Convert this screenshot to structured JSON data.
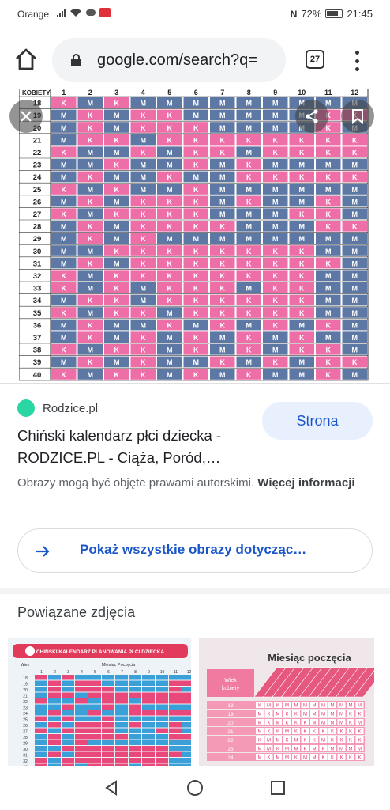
{
  "status_bar": {
    "carrier": "Orange",
    "nfc": "N",
    "battery": "72%",
    "time": "21:45"
  },
  "browser": {
    "url": "google.com/search?q=",
    "tab_count": "27"
  },
  "image_preview": {
    "header_row_label": "KOBIETY",
    "months": [
      "1",
      "2",
      "3",
      "4",
      "5",
      "6",
      "7",
      "8",
      "9",
      "10",
      "11",
      "12"
    ],
    "ages": [
      "18",
      "19",
      "20",
      "21",
      "22",
      "23",
      "24",
      "25",
      "26",
      "27",
      "28",
      "29",
      "30",
      "31",
      "32",
      "33",
      "34",
      "35",
      "36",
      "37",
      "38",
      "39",
      "40"
    ],
    "rows": [
      "KMKMMMMMMMMM",
      "MKMKKMMMMMKK",
      "MKMKKKMMMMKM",
      "MKKMKKKKKKKK",
      "KMMKMKKMKKKK",
      "MMKMMKMKMMMM",
      "MKMMKMMKKKKK",
      "KMKMMKMMMMMM",
      "MKMKKKMKMMKM",
      "KMKKKKMMMKKM",
      "MKMKKKKMMMKK",
      "MKMKMMMMMMMM",
      "MMKKKKKKKKMM",
      "MKMKKKKKKKKM",
      "KMKKKKKKKKMM",
      "KMKMKKKMKKMM",
      "MKKMKKKKKKMM",
      "KMKKMKKKKKMM",
      "MKMMKMKMKMKM",
      "MKMKMKMKMKMM",
      "KMKKMKMKMKKM",
      "MKMKMMKMKMKK",
      "KMKKMKMKMMKM"
    ],
    "colors": {
      "K": "#ee6ea8",
      "M": "#5d78a4"
    }
  },
  "source": {
    "site": "Rodzice.pl",
    "title": "Chiński kalendarz płci dziecka - RODZICE.PL - Ciąża, Poród,…",
    "visit_label": "Strona",
    "copyright_text": "Obrazy mogą być objęte prawami autorskimi.",
    "more_info": "Więcej informacji",
    "show_all_label": "Pokaż wszystkie obrazy dotycząc…"
  },
  "related": {
    "heading": "Powiązane zdjęcia",
    "thumb1_title": "CHIŃSKI KALENDARZ PLANOWANIA PŁCI DZIECKA",
    "thumb1_subtitle": "Miesiąc Poczęcia",
    "thumb1_corner": "Wiek",
    "thumb2_title": "Miesiąc poczęcia",
    "thumb2_corner1": "Wiek",
    "thumb2_corner2": "kobiety",
    "thumb2_ages": [
      "18",
      "19",
      "20",
      "21",
      "22",
      "23",
      "24"
    ]
  },
  "icons": {
    "home": "home-icon",
    "lock": "lock-icon",
    "tabs": "tab-switcher-icon",
    "menu": "more-vert-icon",
    "close": "close-icon",
    "share": "share-icon",
    "save": "bookmark-icon",
    "arrow": "arrow-right-icon",
    "back": "back-icon",
    "home_nav": "home-nav-icon",
    "recents": "recents-icon"
  }
}
